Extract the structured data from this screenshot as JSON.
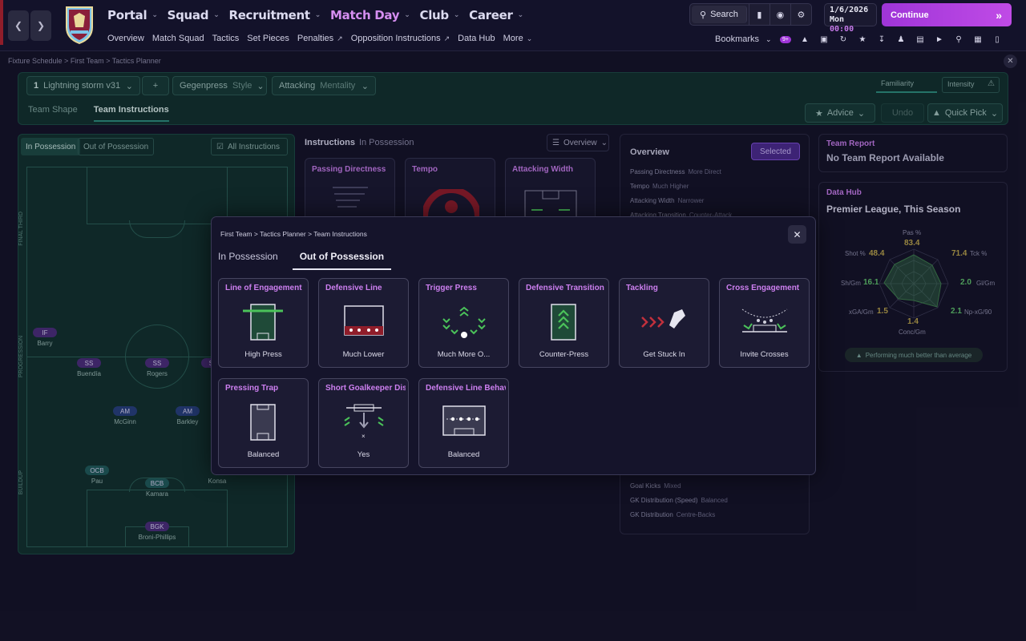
{
  "nav": {
    "back_icon": "chevron-left-icon",
    "forward_icon": "chevron-right-icon",
    "main": [
      {
        "label": "Portal",
        "active": false
      },
      {
        "label": "Squad",
        "active": false
      },
      {
        "label": "Recruitment",
        "active": false
      },
      {
        "label": "Match Day",
        "active": true
      },
      {
        "label": "Club",
        "active": false
      },
      {
        "label": "Career",
        "active": false
      }
    ],
    "sub": [
      "Overview",
      "Match Squad",
      "Tactics",
      "Set Pieces",
      "Penalties",
      "Opposition Instructions",
      "Data Hub",
      "More"
    ],
    "search_label": "Search",
    "date": "1/6/2026",
    "day": "Mon",
    "time": "00:00",
    "continue_label": "Continue",
    "bookmarks_label": "Bookmarks",
    "inbox_count": "9+"
  },
  "breadcrumb": [
    "Fixture Schedule",
    "First Team",
    "Tactics Planner"
  ],
  "tactic": {
    "slot": "1",
    "name": "Lightning storm v31",
    "add": "+",
    "style_value": "Gegenpress",
    "style_label": "Style",
    "mentality_value": "Attacking",
    "mentality_label": "Mentality",
    "familiarity": "Familiarity",
    "intensity": "Intensity",
    "tabs": [
      "Team Shape",
      "Team Instructions"
    ],
    "active_tab": "Team Instructions",
    "advice": "Advice",
    "undo": "Undo",
    "quick_pick": "Quick Pick"
  },
  "pitch": {
    "tabs": [
      "In Possession",
      "Out of Possession"
    ],
    "all_instructions": "All Instructions",
    "zones": [
      "FINAL THIRD",
      "PROGRESSION",
      "BUILDUP"
    ],
    "players": [
      {
        "pos": "IF",
        "name": "Barry",
        "color": "#4a2d78"
      },
      {
        "pos": "SS",
        "name": "Buendía",
        "color": "#4a2d78"
      },
      {
        "pos": "SS",
        "name": "Rogers",
        "color": "#4a2d78"
      },
      {
        "pos": "SS",
        "name": "El",
        "color": "#4a2d78"
      },
      {
        "pos": "AM",
        "name": "McGinn",
        "color": "#273f7a"
      },
      {
        "pos": "AM",
        "name": "Barkley",
        "color": "#273f7a"
      },
      {
        "pos": "OCB",
        "name": "Pau",
        "color": "#1f5a58"
      },
      {
        "pos": "BCB",
        "name": "Kamara",
        "color": "#1f5a58"
      },
      {
        "pos": "",
        "name": "Konsa",
        "color": "#1f5a58"
      },
      {
        "pos": "BGK",
        "name": "Broni-Phillips",
        "color": "#4a2d78"
      }
    ]
  },
  "instructions": {
    "title": "Instructions",
    "context": "In Possession",
    "view": "Overview",
    "cards": [
      "Passing Directness",
      "Tempo",
      "Attacking Width"
    ]
  },
  "overview": {
    "title": "Overview",
    "selected": "Selected",
    "rows_top": [
      {
        "k": "Passing Directness",
        "v": "More Direct"
      },
      {
        "k": "Tempo",
        "v": "Much Higher"
      },
      {
        "k": "Attacking Width",
        "v": "Narrower"
      },
      {
        "k": "Attacking Transition",
        "v": "Counter-Attack"
      }
    ],
    "rows_bottom": [
      {
        "k": "Goal Kicks",
        "v": "Mixed"
      },
      {
        "k": "GK Distribution (Speed)",
        "v": "Balanced"
      },
      {
        "k": "GK Distribution",
        "v": "Centre-Backs"
      }
    ]
  },
  "team_report": {
    "title": "Team Report",
    "text": "No Team Report Available"
  },
  "data_hub": {
    "title": "Data Hub",
    "subtitle": "Premier League, This Season",
    "stats": [
      {
        "label": "Pas %",
        "value": "83.4",
        "color": "#b8a24a"
      },
      {
        "label": "Tck %",
        "value": "71.4",
        "color": "#b8a24a"
      },
      {
        "label": "Gl/Gm",
        "value": "2.0",
        "color": "#5fbf6a"
      },
      {
        "label": "Np-xG/90",
        "value": "2.1",
        "color": "#5fbf6a"
      },
      {
        "label": "Conc/Gm",
        "value": "1.4",
        "color": "#b8a24a"
      },
      {
        "label": "xGA/Gm",
        "value": "1.5",
        "color": "#b8a24a"
      },
      {
        "label": "Sh/Gm",
        "value": "16.1",
        "color": "#5fbf6a"
      },
      {
        "label": "Shot %",
        "value": "48.4",
        "color": "#b8a24a"
      }
    ],
    "performance": "Performing much better than average"
  },
  "modal": {
    "breadcrumb": [
      "First Team",
      "Tactics Planner",
      "Team Instructions"
    ],
    "tabs": [
      "In Possession",
      "Out of Possession"
    ],
    "active_tab": "Out of Possession",
    "cards": [
      {
        "title": "Line of Engagement",
        "value": "High Press",
        "icon": "line-of-engagement-icon"
      },
      {
        "title": "Defensive Line",
        "value": "Much Lower",
        "icon": "defensive-line-icon"
      },
      {
        "title": "Trigger Press",
        "value": "Much More O...",
        "icon": "trigger-press-icon"
      },
      {
        "title": "Defensive Transition",
        "value": "Counter-Press",
        "icon": "defensive-transition-icon"
      },
      {
        "title": "Tackling",
        "value": "Get Stuck In",
        "icon": "tackling-icon"
      },
      {
        "title": "Cross Engagement",
        "value": "Invite Crosses",
        "icon": "cross-engagement-icon"
      },
      {
        "title": "Pressing Trap",
        "value": "Balanced",
        "icon": "pressing-trap-icon"
      },
      {
        "title": "Short Goalkeeper Distr",
        "value": "Yes",
        "icon": "short-gk-distribution-icon"
      },
      {
        "title": "Defensive Line Behavic",
        "value": "Balanced",
        "icon": "defensive-line-behaviour-icon"
      }
    ]
  }
}
